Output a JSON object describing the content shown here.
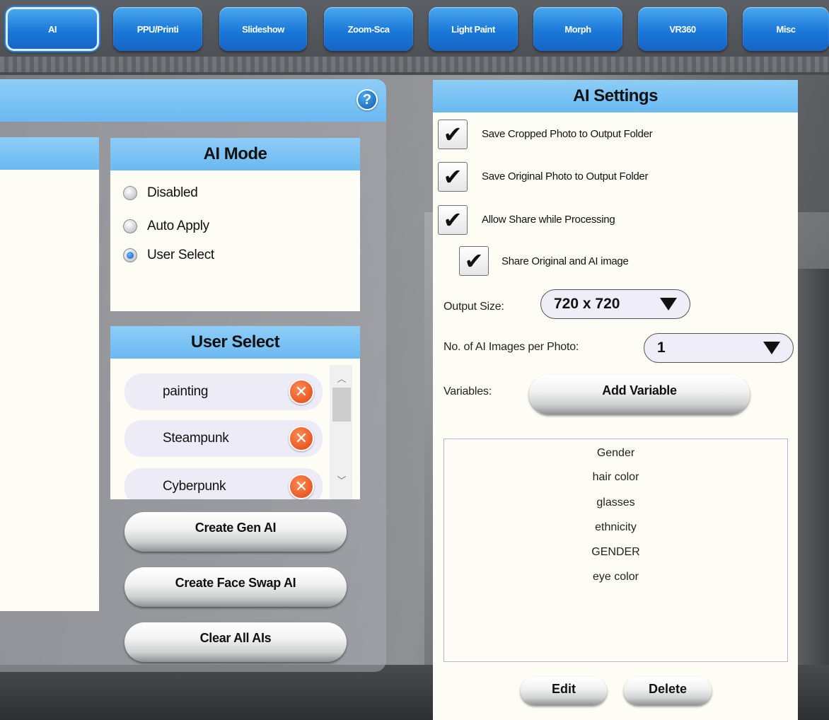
{
  "tabs": [
    {
      "label": "AI",
      "active": true
    },
    {
      "label": "PPU/Printi"
    },
    {
      "label": "Slideshow"
    },
    {
      "label": "Zoom-Sca"
    },
    {
      "label": "Light Paint"
    },
    {
      "label": "Morph"
    },
    {
      "label": "VR360"
    },
    {
      "label": "Misc"
    }
  ],
  "help": {
    "symbol": "?"
  },
  "ai_mode": {
    "title": "AI Mode",
    "options": [
      "Disabled",
      "Auto Apply",
      "User Select"
    ],
    "selected": "User Select"
  },
  "user_select": {
    "title": "User Select",
    "items": [
      "painting",
      "Steampunk",
      "Cyberpunk"
    ]
  },
  "left_buttons": {
    "create_gen_ai": "Create Gen AI",
    "create_face_swap_ai": "Create Face Swap AI",
    "clear_all_ais": "Clear All AIs"
  },
  "ai_settings": {
    "title": "AI Settings",
    "checkboxes": [
      {
        "label": "Save Cropped Photo to Output Folder",
        "checked": true
      },
      {
        "label": "Save Original Photo to Output Folder",
        "checked": true
      },
      {
        "label": "Allow Share while Processing",
        "checked": true
      },
      {
        "label": "Share Original and AI image",
        "checked": true
      }
    ],
    "output_size_label": "Output Size:",
    "output_size_value": "720 x 720",
    "images_per_photo_label": "No. of AI Images per Photo:",
    "images_per_photo_value": "1",
    "variables_label": "Variables:",
    "add_variable": "Add Variable",
    "variables": [
      "Gender",
      "hair color",
      "glasses",
      "ethnicity",
      "GENDER",
      "eye color"
    ],
    "edit": "Edit",
    "delete": "Delete"
  },
  "colors": {
    "tab_blue": "#1b78d8",
    "header_blue": "#8ecdf7",
    "remove_orange": "#e0450e",
    "radio_selected": "#0b5bc4"
  }
}
